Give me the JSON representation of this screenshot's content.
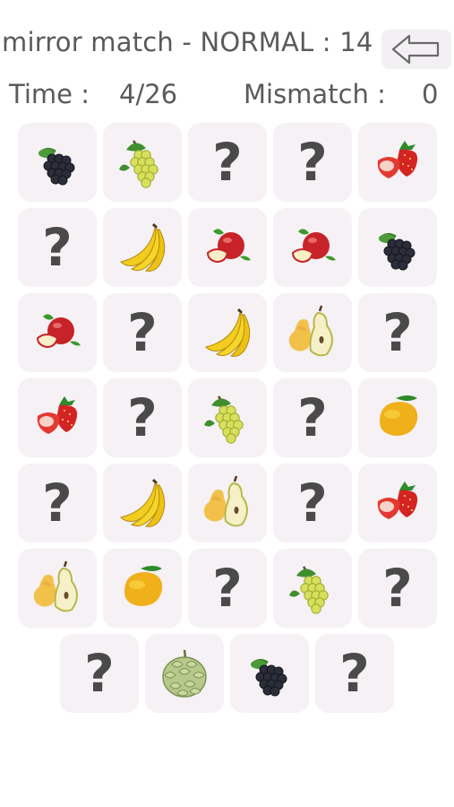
{
  "header": {
    "title": "mirror match - NORMAL : 14",
    "time_label": "Time :",
    "time_value": "4/26",
    "mismatch_label": "Mismatch :",
    "mismatch_value": "0"
  },
  "hidden_symbol": "?",
  "cards": [
    [
      "grapes-dark",
      "grapes-green",
      "hidden",
      "hidden",
      "strawberry"
    ],
    [
      "hidden",
      "banana",
      "apple",
      "apple",
      "grapes-dark"
    ],
    [
      "apple",
      "hidden",
      "banana",
      "pear",
      "hidden"
    ],
    [
      "strawberry",
      "hidden",
      "grapes-green",
      "hidden",
      "mango"
    ],
    [
      "hidden",
      "banana",
      "pear",
      "hidden",
      "strawberry"
    ],
    [
      "pear",
      "mango",
      "hidden",
      "grapes-green",
      "hidden"
    ],
    [
      "hidden",
      "custard-apple",
      "grapes-dark",
      "hidden"
    ]
  ],
  "colors": {
    "card_bg": "#f5f1f4",
    "text": "#5a5a5a",
    "question": "#4a4a4a"
  }
}
